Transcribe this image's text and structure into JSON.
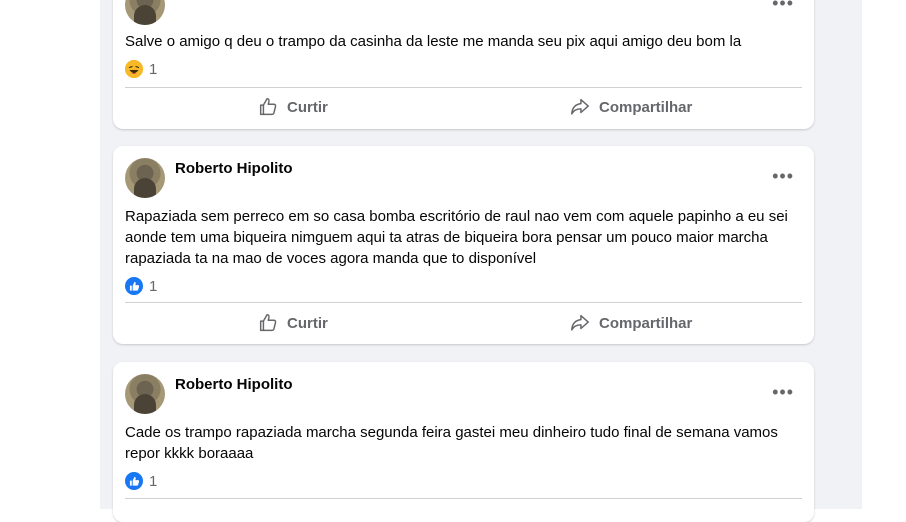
{
  "posts": [
    {
      "author": "",
      "text": "Salve o amigo q deu o trampo da casinha da leste me manda seu pix aqui amigo deu bom la",
      "reaction_type": "haha",
      "reaction_count": "1"
    },
    {
      "author": "Roberto Hipolito",
      "text": "Rapaziada sem perreco em so casa bomba escritório de raul nao vem com aquele papinho a eu sei aonde tem uma biqueira nimguem aqui ta atras de biqueira bora pensar um pouco maior marcha rapaziada ta na mao de voces agora manda que to disponível",
      "reaction_type": "like",
      "reaction_count": "1"
    },
    {
      "author": "Roberto Hipolito",
      "text": "Cade os trampo rapaziada marcha segunda feira gastei meu dinheiro tudo final de semana vamos repor kkkk boraaaa",
      "reaction_type": "like",
      "reaction_count": "1"
    }
  ],
  "actions": {
    "like_label": "Curtir",
    "share_label": "Compartilhar"
  },
  "more_label": "•••",
  "colors": {
    "like_blue": "#1877f2",
    "muted": "#65676b",
    "feed_bg": "#f0f2f5"
  }
}
